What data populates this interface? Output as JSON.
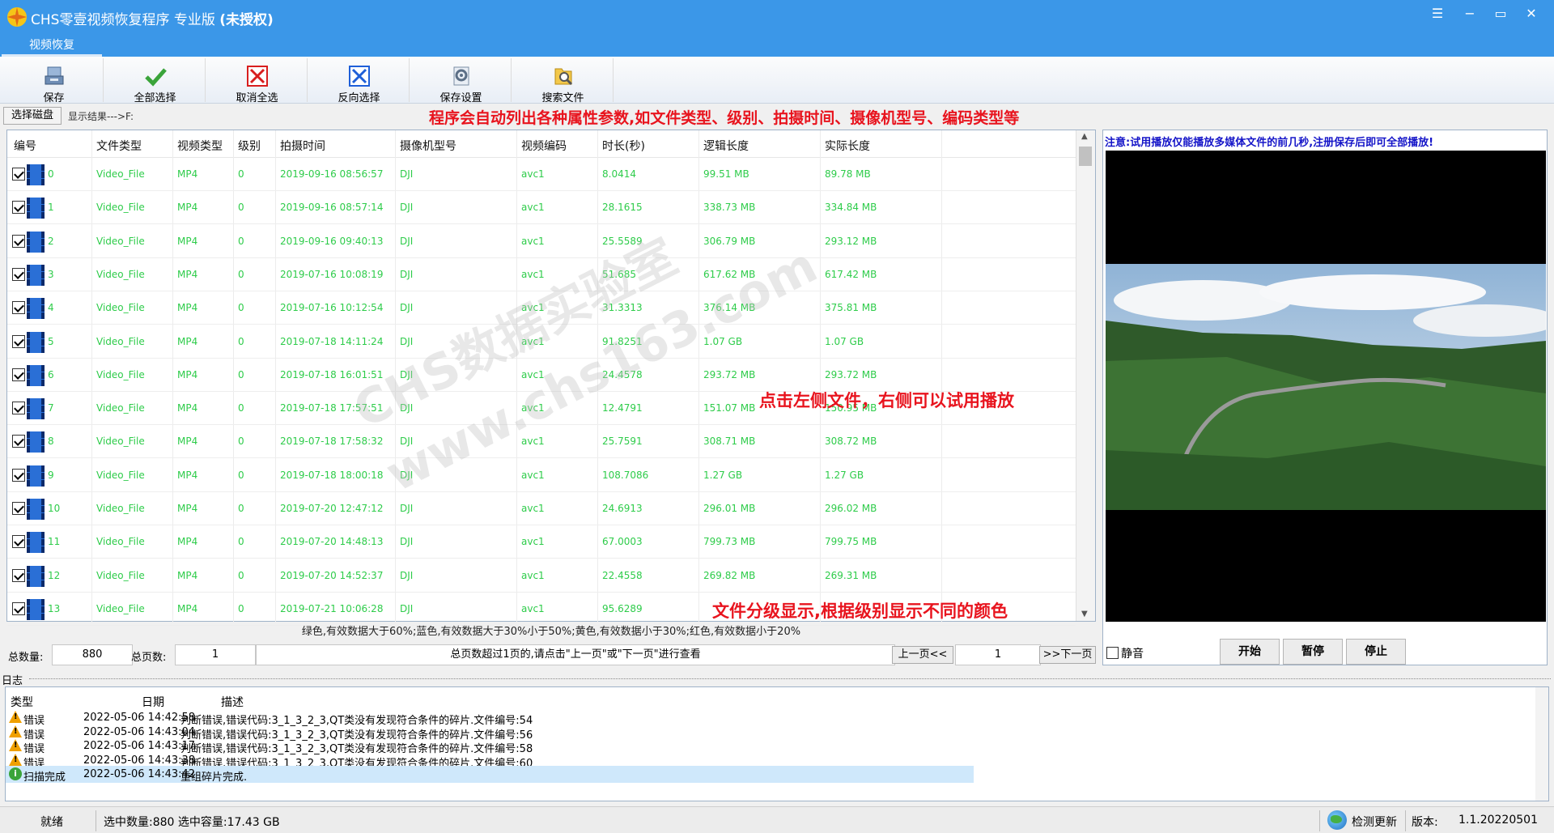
{
  "app": {
    "title_main": "CHS零壹视频恢复程序 专业版",
    "title_suffix": "(未授权)",
    "window_buttons": [
      "menu-icon",
      "minimize-icon",
      "restore-icon",
      "close-icon"
    ]
  },
  "tabs": [
    {
      "label": "视频恢复",
      "active": true
    }
  ],
  "toolbar": {
    "buttons": [
      {
        "label": "保存",
        "icon": "save-icon"
      },
      {
        "label": "全部选择",
        "icon": "check-all-icon"
      },
      {
        "label": "取消全选",
        "icon": "uncheck-all-icon"
      },
      {
        "label": "反向选择",
        "icon": "invert-selection-icon"
      },
      {
        "label": "保存设置",
        "icon": "settings-icon"
      },
      {
        "label": "搜索文件",
        "icon": "search-file-icon"
      }
    ]
  },
  "pathbar": {
    "select_disk": "选择磁盘",
    "result_prefix": "显示结果--->F:"
  },
  "annotations": {
    "top": "程序会自动列出各种属性参数,如文件类型、级别、拍摄时间、摄像机型号、编码类型等",
    "middle": "点击左侧文件，右侧可以试用播放",
    "bottom": "文件分级显示,根据级别显示不同的颜色"
  },
  "watermark": {
    "line1": "CHS数据实验室",
    "line2": "www.chs163.com"
  },
  "table": {
    "columns": [
      "编号",
      "文件类型",
      "视频类型",
      "级别",
      "拍摄时间",
      "摄像机型号",
      "视频编码",
      "时长(秒)",
      "逻辑长度",
      "实际长度"
    ],
    "rows": [
      {
        "id": "0",
        "file_type": "Video_File",
        "video_type": "MP4",
        "level": "0",
        "time": "2019-09-16 08:56:57",
        "camera": "DJI",
        "codec": "avc1",
        "duration": "8.0414",
        "logical": "99.51 MB",
        "actual": "89.78 MB"
      },
      {
        "id": "1",
        "file_type": "Video_File",
        "video_type": "MP4",
        "level": "0",
        "time": "2019-09-16 08:57:14",
        "camera": "DJI",
        "codec": "avc1",
        "duration": "28.1615",
        "logical": "338.73 MB",
        "actual": "334.84 MB"
      },
      {
        "id": "2",
        "file_type": "Video_File",
        "video_type": "MP4",
        "level": "0",
        "time": "2019-09-16 09:40:13",
        "camera": "DJI",
        "codec": "avc1",
        "duration": "25.5589",
        "logical": "306.79 MB",
        "actual": "293.12 MB"
      },
      {
        "id": "3",
        "file_type": "Video_File",
        "video_type": "MP4",
        "level": "0",
        "time": "2019-07-16 10:08:19",
        "camera": "DJI",
        "codec": "avc1",
        "duration": "51.685",
        "logical": "617.62 MB",
        "actual": "617.42 MB"
      },
      {
        "id": "4",
        "file_type": "Video_File",
        "video_type": "MP4",
        "level": "0",
        "time": "2019-07-16 10:12:54",
        "camera": "DJI",
        "codec": "avc1",
        "duration": "31.3313",
        "logical": "376.14 MB",
        "actual": "375.81 MB"
      },
      {
        "id": "5",
        "file_type": "Video_File",
        "video_type": "MP4",
        "level": "0",
        "time": "2019-07-18 14:11:24",
        "camera": "DJI",
        "codec": "avc1",
        "duration": "91.8251",
        "logical": "1.07 GB",
        "actual": "1.07 GB"
      },
      {
        "id": "6",
        "file_type": "Video_File",
        "video_type": "MP4",
        "level": "0",
        "time": "2019-07-18 16:01:51",
        "camera": "DJI",
        "codec": "avc1",
        "duration": "24.4578",
        "logical": "293.72 MB",
        "actual": "293.72 MB"
      },
      {
        "id": "7",
        "file_type": "Video_File",
        "video_type": "MP4",
        "level": "0",
        "time": "2019-07-18 17:57:51",
        "camera": "DJI",
        "codec": "avc1",
        "duration": "12.4791",
        "logical": "151.07 MB",
        "actual": "150.95 MB"
      },
      {
        "id": "8",
        "file_type": "Video_File",
        "video_type": "MP4",
        "level": "0",
        "time": "2019-07-18 17:58:32",
        "camera": "DJI",
        "codec": "avc1",
        "duration": "25.7591",
        "logical": "308.71 MB",
        "actual": "308.72 MB"
      },
      {
        "id": "9",
        "file_type": "Video_File",
        "video_type": "MP4",
        "level": "0",
        "time": "2019-07-18 18:00:18",
        "camera": "DJI",
        "codec": "avc1",
        "duration": "108.7086",
        "logical": "1.27 GB",
        "actual": "1.27 GB"
      },
      {
        "id": "10",
        "file_type": "Video_File",
        "video_type": "MP4",
        "level": "0",
        "time": "2019-07-20 12:47:12",
        "camera": "DJI",
        "codec": "avc1",
        "duration": "24.6913",
        "logical": "296.01 MB",
        "actual": "296.02 MB"
      },
      {
        "id": "11",
        "file_type": "Video_File",
        "video_type": "MP4",
        "level": "0",
        "time": "2019-07-20 14:48:13",
        "camera": "DJI",
        "codec": "avc1",
        "duration": "67.0003",
        "logical": "799.73 MB",
        "actual": "799.75 MB"
      },
      {
        "id": "12",
        "file_type": "Video_File",
        "video_type": "MP4",
        "level": "0",
        "time": "2019-07-20 14:52:37",
        "camera": "DJI",
        "codec": "avc1",
        "duration": "22.4558",
        "logical": "269.82 MB",
        "actual": "269.31 MB"
      },
      {
        "id": "13",
        "file_type": "Video_File",
        "video_type": "MP4",
        "level": "0",
        "time": "2019-07-21 10:06:28",
        "camera": "DJI",
        "codec": "avc1",
        "duration": "95.6289",
        "logical": "",
        "actual": ""
      }
    ],
    "row_color": "#2ecc4a"
  },
  "legend": "绿色,有效数据大于60%;蓝色,有效数据大于30%小于50%;黄色,有效数据小于30%;红色,有效数据小于20%",
  "pager": {
    "total_label": "总数量:",
    "total_value": "880",
    "pages_label": "总页数:",
    "pages_value": "1",
    "hint": "总页数超过1页的,请点击\"上一页\"或\"下一页\"进行查看",
    "prev": "上一页<<",
    "current": "1",
    "next": ">>下一页"
  },
  "preview": {
    "note": "注意:试用播放仅能播放多媒体文件的前几秒,注册保存后即可全部播放!",
    "mute": "静音",
    "start": "开始",
    "pause": "暂停",
    "stop": "停止"
  },
  "log": {
    "label": "日志",
    "columns": [
      "类型",
      "日期",
      "描述"
    ],
    "rows": [
      {
        "icon": "warning-icon",
        "type": "错误",
        "date": "2022-05-06 14:42:58",
        "desc": "判断错误,错误代码:3_1_3_2_3,QT类没有发现符合条件的碎片.文件编号:54"
      },
      {
        "icon": "warning-icon",
        "type": "错误",
        "date": "2022-05-06 14:43:04",
        "desc": "判断错误,错误代码:3_1_3_2_3,QT类没有发现符合条件的碎片.文件编号:56"
      },
      {
        "icon": "warning-icon",
        "type": "错误",
        "date": "2022-05-06 14:43:17",
        "desc": "判断错误,错误代码:3_1_3_2_3,QT类没有发现符合条件的碎片.文件编号:58"
      },
      {
        "icon": "warning-icon",
        "type": "错误",
        "date": "2022-05-06 14:43:38",
        "desc": "判断错误,错误代码:3_1_3_2_3,QT类没有发现符合条件的碎片.文件编号:60"
      },
      {
        "icon": "info-icon",
        "type": "扫描完成",
        "date": "2022-05-06 14:43:42",
        "desc": "重组碎片完成.",
        "selected": true
      }
    ]
  },
  "status": {
    "ready": "就绪",
    "selection": "选中数量:880 选中容量:17.43 GB",
    "update": "检测更新",
    "version_label": "版本:",
    "version": "1.1.20220501"
  },
  "colors": {
    "titlebar": "#3b97e8",
    "annotation": "#e8141e",
    "note": "#1414c8"
  }
}
